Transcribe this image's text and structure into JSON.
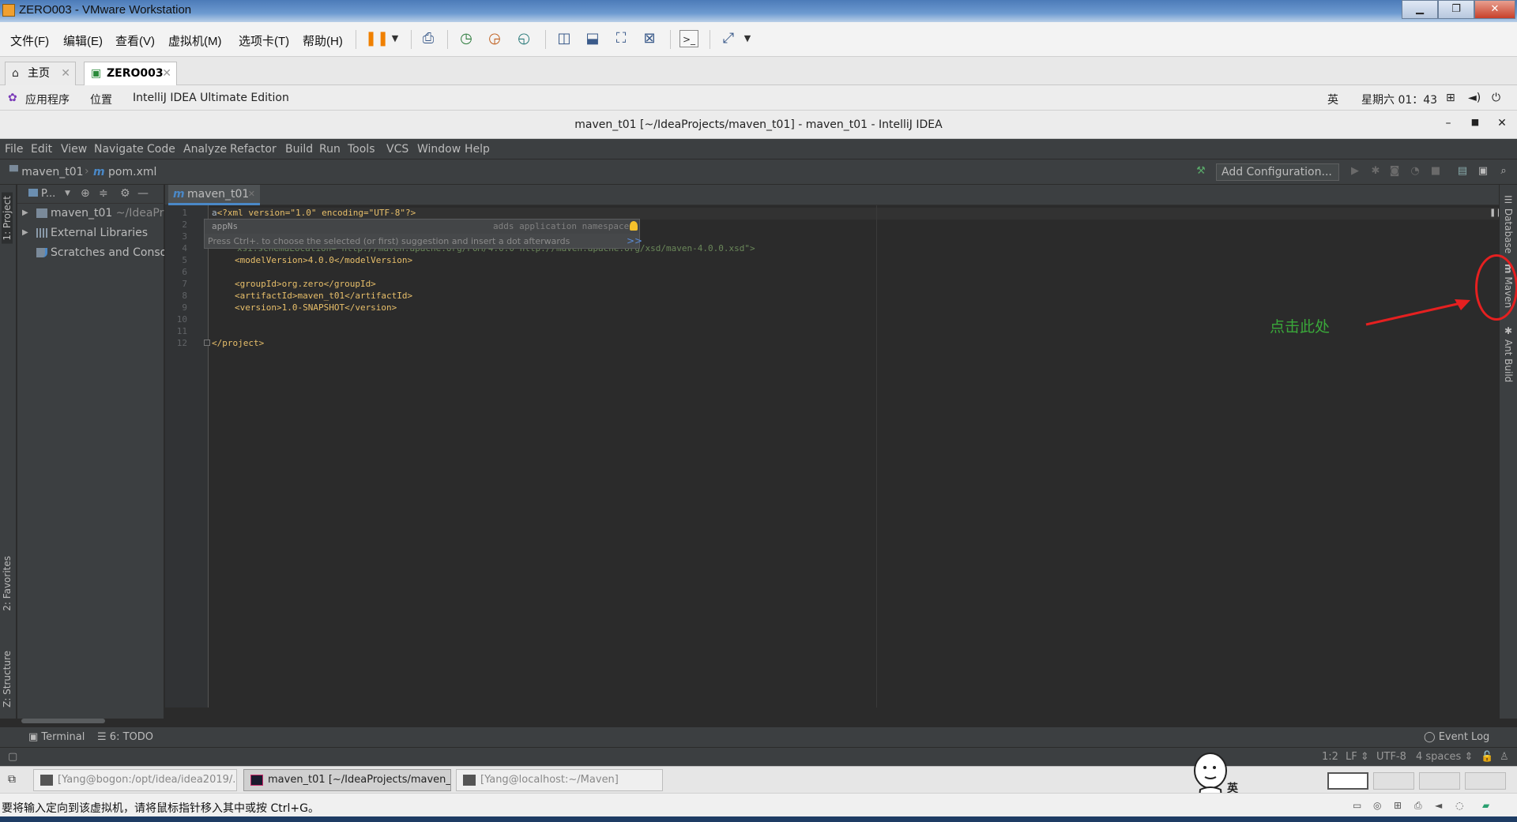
{
  "vmware": {
    "title": "ZERO003 - VMware Workstation",
    "menu": [
      "文件(F)",
      "编辑(E)",
      "查看(V)",
      "虚拟机(M)",
      "选项卡(T)",
      "帮助(H)"
    ],
    "tabs": [
      {
        "label": "主页"
      },
      {
        "label": "ZERO003"
      }
    ],
    "status_text": "要将输入定向到该虚拟机，请将鼠标指针移入其中或按 Ctrl+G。"
  },
  "gnome": {
    "applications": "应用程序",
    "places": "位置",
    "active_app": "IntelliJ IDEA Ultimate Edition",
    "ime": "英",
    "clock": "星期六 01：43"
  },
  "idea": {
    "window_title": "maven_t01 [~/IdeaProjects/maven_t01] - maven_t01 - IntelliJ IDEA",
    "menu": [
      "File",
      "Edit",
      "View",
      "Navigate",
      "Code",
      "Analyze",
      "Refactor",
      "Build",
      "Run",
      "Tools",
      "VCS",
      "Window",
      "Help"
    ],
    "nav": {
      "project": "maven_t01",
      "file": "pom.xml",
      "file_prefix": "m"
    },
    "add_configuration": "Add Configuration...",
    "left_tabs": [
      "1: Project",
      "2: Favorites",
      "Z: Structure"
    ],
    "right_tabs": [
      "Database",
      "Maven",
      "Ant Build"
    ],
    "project_panel": {
      "title": "P...",
      "tree": [
        {
          "label": "maven_t01",
          "suffix": "~/IdeaPr"
        },
        {
          "label": "External Libraries"
        },
        {
          "label": "Scratches and Consol"
        }
      ]
    },
    "editor_tab": "maven_t01",
    "line_numbers": [
      "1",
      "2",
      "3",
      "4",
      "5",
      "6",
      "7",
      "8",
      "9",
      "10",
      "11",
      "12"
    ],
    "code": {
      "l1_a": "a",
      "l1_decl": "<?xml version=\"1.0\" encoding=\"UTF-8\"?>",
      "l4": "xsi:schemaLocation=\"http://maven.apache.org/POM/4.0.0 http://maven.apache.org/xsd/maven-4.0.0.xsd\">",
      "l5": "<modelVersion>4.0.0</modelVersion>",
      "l7": "<groupId>org.zero</groupId>",
      "l8": "<artifactId>maven_t01</artifactId>",
      "l9": "<version>1.0-SNAPSHOT</version>",
      "l12": "</project>"
    },
    "autocomplete": {
      "item": "appNs",
      "type": "adds application namespace",
      "hint": "Press Ctrl+. to choose the selected (or first) suggestion and insert a dot afterwards",
      "more": ">>"
    },
    "bottom_tools": {
      "terminal": "Terminal",
      "todo": "6: TODO",
      "event_log": "Event Log"
    },
    "status": {
      "position": "1:2",
      "line_sep": "LF",
      "encoding": "UTF-8",
      "indent": "4 spaces"
    }
  },
  "annotation": {
    "text": "点击此处",
    "color": "#e52020"
  },
  "guest_taskbar": {
    "items": [
      {
        "label": "[Yang@bogon:/opt/idea/idea2019/..."
      },
      {
        "label": "maven_t01 [~/IdeaProjects/maven_..."
      },
      {
        "label": "[Yang@localhost:~/Maven]"
      }
    ],
    "avatar_label": "英"
  }
}
